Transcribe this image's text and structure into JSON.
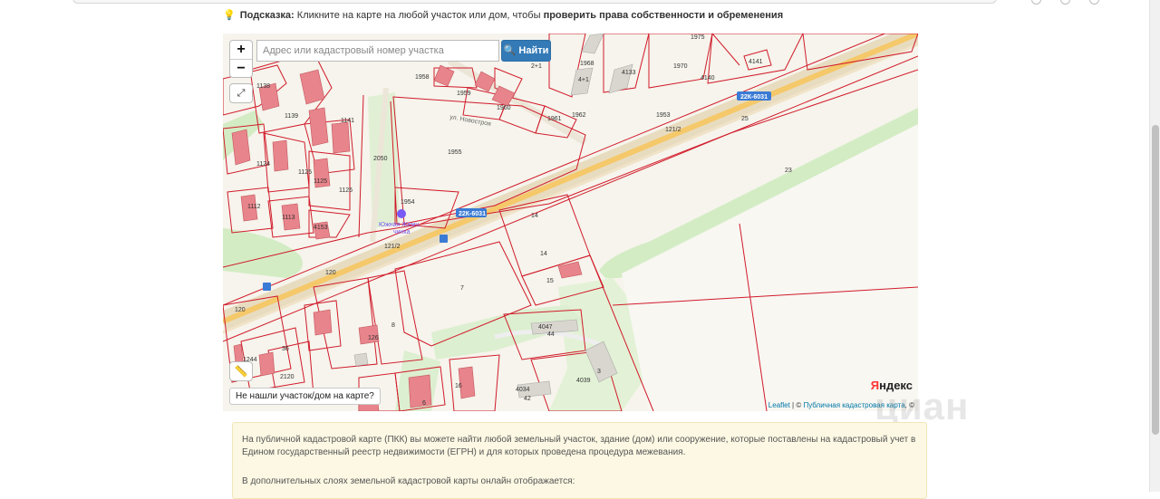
{
  "hint": {
    "label": "Подсказка:",
    "text": "Кликните на карте на любой участок или дом, чтобы",
    "bold": "проверить права собственности и обременения"
  },
  "map": {
    "search_placeholder": "Адрес или кадастровый номер участка",
    "search_value": "",
    "find_button": "Найти",
    "zoom_in": "+",
    "zoom_out": "−",
    "not_found": "Не нашли участок/дом на карте?",
    "brand": "Яндекс",
    "attribution_leaflet": "Leaflet",
    "attribution_sep": " | © ",
    "attribution_pkk": "Публичная кадастровая карта",
    "attribution_end": ", ©",
    "road_badge": "22К-6031",
    "street": "ул. Новостроя",
    "poi_name": "Южная Жемчужинка",
    "parcel_labels": [
      "1975",
      "1968",
      "4133",
      "1970",
      "4140",
      "4141",
      "1958",
      "1959",
      "1960",
      "1961",
      "1962",
      "1953",
      "25",
      "121/2",
      "1955",
      "1138",
      "1139",
      "1141",
      "1124",
      "1125",
      "1126",
      "2050",
      "1112",
      "1113",
      "4153",
      "1954",
      "14",
      "15",
      "7",
      "8",
      "23",
      "120",
      "36",
      "1244",
      "2120",
      "4047",
      "44",
      "4039",
      "4034",
      "16",
      "6",
      "2+1",
      "4+1"
    ]
  },
  "watermark": "циан",
  "info": {
    "p1": "На публичной кадастровой карте (ПКК) вы можете найти любой земельный участок, здание (дом) или сооружение, которые поставлены на кадастровый учет в Едином государственный реестр недвижимости (ЕГРН) и для которых проведена процедура межевания.",
    "p2": "В дополнительных слоях земельной кадастровой карты онлайн отображается:"
  },
  "colors": {
    "parcel_border": "#d11a2a",
    "road": "#f5c86a",
    "green": "#d3ecc4",
    "button": "#337ab7",
    "info_bg": "#fcf8e3"
  }
}
